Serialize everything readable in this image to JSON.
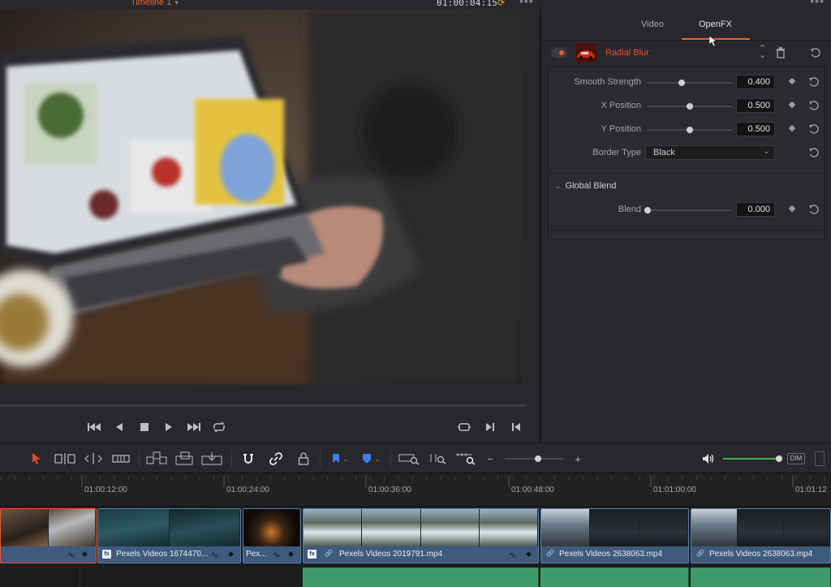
{
  "viewer": {
    "timeline_name": "Timeline 1",
    "timecode": "01:00:04:15"
  },
  "inspector": {
    "tabs": [
      {
        "label": "Video",
        "active": false
      },
      {
        "label": "OpenFX",
        "active": true
      }
    ],
    "effect": {
      "name": "Radial Blur",
      "enabled": true,
      "params": [
        {
          "label": "Smooth Strength",
          "value": "0.400",
          "level": 0.4
        },
        {
          "label": "X Position",
          "value": "0.500",
          "level": 0.5
        },
        {
          "label": "Y Position",
          "value": "0.500",
          "level": 0.5
        }
      ],
      "border_type": {
        "label": "Border Type",
        "value": "Black"
      },
      "global_blend": {
        "section_label": "Global Blend",
        "blend": {
          "label": "Blend",
          "value": "0.000",
          "level": 0.0
        }
      }
    }
  },
  "toolbar": {
    "zoom_level": 0.55,
    "volume_level": 1.0,
    "dim_label": "DIM"
  },
  "timeline": {
    "ruler": [
      "01:00:12:00",
      "01:00:24:00",
      "01:00:36:00",
      "01:00:48:00",
      "01:01:00:00",
      "01:01:12"
    ],
    "clips": [
      {
        "title": "",
        "selected": true,
        "fx": false,
        "link": false
      },
      {
        "title": "Pexels Videos 1674470...",
        "selected": false,
        "fx": true,
        "link": false
      },
      {
        "title": "Pex...",
        "selected": false,
        "fx": false,
        "link": false
      },
      {
        "title": "Pexels Videos 2019791.mp4",
        "selected": false,
        "fx": true,
        "link": true
      },
      {
        "title": "Pexels Videos 2638063.mp4",
        "selected": false,
        "fx": false,
        "link": true
      },
      {
        "title": "Pexels Videos 2638063.mp4",
        "selected": false,
        "fx": false,
        "link": true
      }
    ]
  },
  "colors": {
    "accent": "#e8572f",
    "clip_blue": "#3e5a7c",
    "audio_green": "#3f9a6b",
    "volume_green": "#3fae49"
  }
}
